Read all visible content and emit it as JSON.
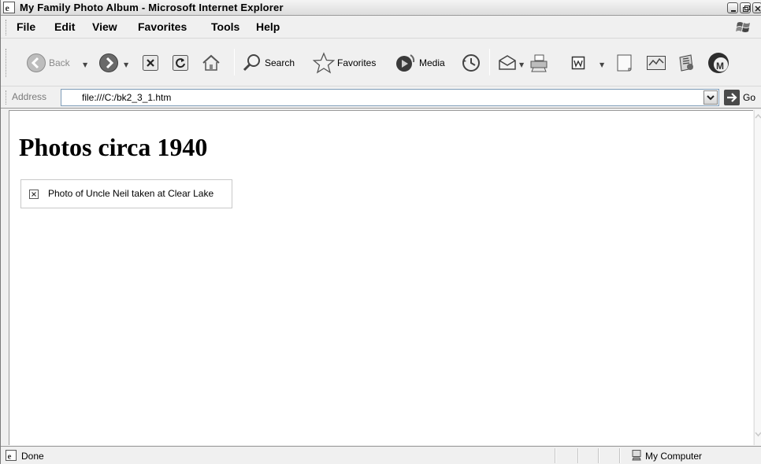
{
  "window": {
    "title": "My Family Photo Album - Microsoft Internet Explorer"
  },
  "menu": {
    "items": [
      "File",
      "Edit",
      "View",
      "Favorites",
      "Tools",
      "Help"
    ]
  },
  "toolbar": {
    "back_label": "Back",
    "search_label": "Search",
    "favorites_label": "Favorites",
    "media_label": "Media"
  },
  "address": {
    "label": "Address",
    "value": "file:///C:/bk2_3_1.htm",
    "go_label": "Go"
  },
  "page": {
    "heading": "Photos circa 1940",
    "image_alt": "Photo of Uncle Neil taken at Clear Lake"
  },
  "status": {
    "text": "Done",
    "zone": "My Computer"
  },
  "colors": {
    "chrome": "#f0f0f0",
    "border": "#9a9a9a",
    "address_border": "#7f9db9"
  }
}
